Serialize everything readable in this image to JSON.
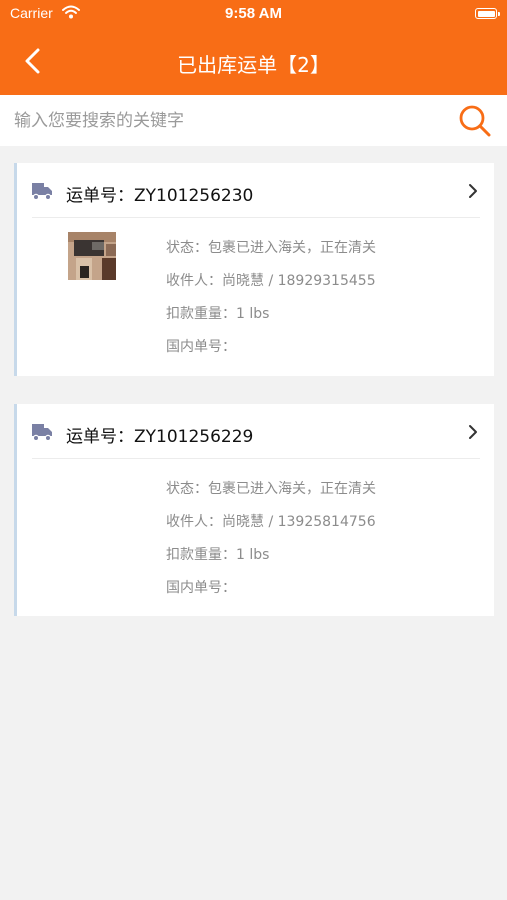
{
  "status_bar": {
    "carrier": "Carrier",
    "time": "9:58 AM"
  },
  "nav": {
    "title": "已出库运单【2】"
  },
  "search": {
    "placeholder": "输入您要搜索的关键字",
    "value": ""
  },
  "colors": {
    "brand": "#f86d16",
    "accent_bar": "#c7d9ea",
    "truck_icon": "#7a80a4"
  },
  "orders": [
    {
      "waybill": "运单号：ZY101256230",
      "has_photo": true,
      "status": "状态：包裹已进入海关，正在清关",
      "recipient": "收件人：尚晓慧 / 18929315455",
      "weight": "扣款重量：1 lbs",
      "domestic": "国内单号："
    },
    {
      "waybill": "运单号：ZY101256229",
      "has_photo": false,
      "status": "状态：包裹已进入海关，正在清关",
      "recipient": "收件人：尚晓慧 / 13925814756",
      "weight": "扣款重量：1 lbs",
      "domestic": "国内单号："
    }
  ]
}
